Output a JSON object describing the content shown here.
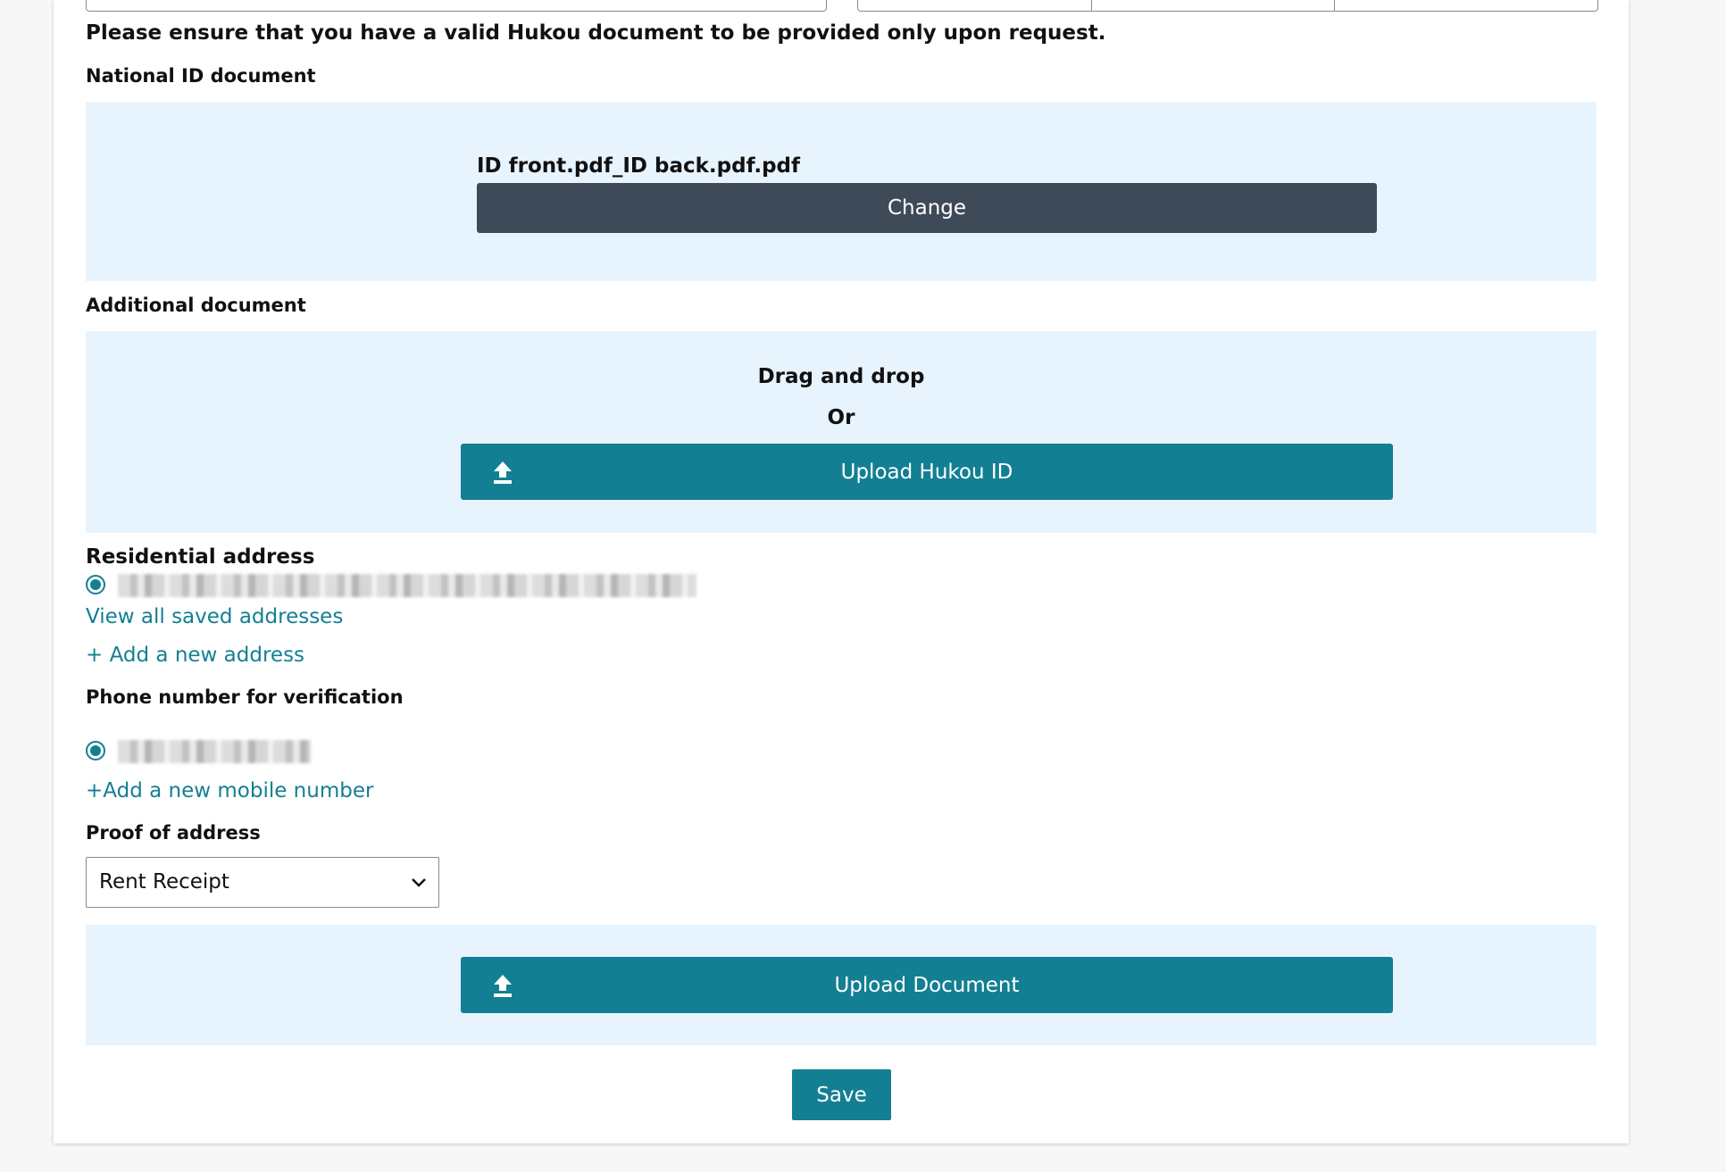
{
  "form": {
    "notice": "Please ensure that you have a valid Hukou document to be provided only upon request.",
    "national_id": {
      "label": "National ID document",
      "file_name": "ID front.pdf_ID back.pdf.pdf",
      "change_label": "Change"
    },
    "additional_document": {
      "label": "Additional document",
      "drag_text": "Drag and drop",
      "or_text": "Or",
      "upload_label": "Upload Hukou ID"
    },
    "residential_address": {
      "label": "Residential address",
      "view_all_link": "View all saved addresses",
      "add_link": "+ Add a new address"
    },
    "phone": {
      "label": "Phone number for verification",
      "add_link": "+Add a new mobile number"
    },
    "proof_of_address": {
      "label": "Proof of address",
      "selected": "Rent Receipt",
      "upload_label": "Upload Document"
    },
    "save_label": "Save"
  },
  "colors": {
    "accent": "#137f93",
    "dark_button": "#3f4a58",
    "dropzone_bg": "#e8f4fd"
  }
}
